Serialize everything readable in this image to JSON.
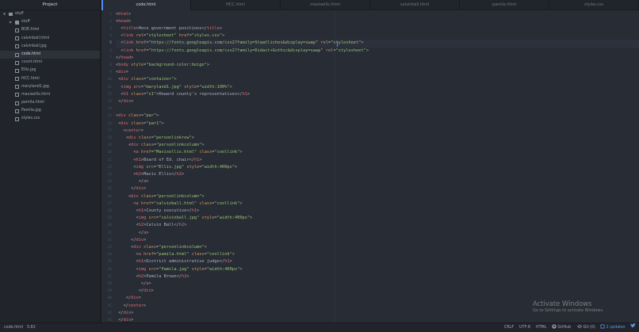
{
  "tree": {
    "header": "Project",
    "items": [
      {
        "label": "stuff",
        "type": "folder",
        "expanded": true,
        "depth": 0
      },
      {
        "label": "stuff",
        "type": "folder",
        "expanded": false,
        "depth": 1
      },
      {
        "label": "BOE.html",
        "type": "file",
        "depth": 1
      },
      {
        "label": "calvinball.html",
        "type": "file",
        "depth": 1
      },
      {
        "label": "calvinball.jpg",
        "type": "file",
        "depth": 1
      },
      {
        "label": "code.html",
        "type": "file",
        "depth": 1,
        "selected": true
      },
      {
        "label": "count.html",
        "type": "file",
        "depth": 1
      },
      {
        "label": "Ellis.jpg",
        "type": "file",
        "depth": 1
      },
      {
        "label": "HCC.html",
        "type": "file",
        "depth": 1
      },
      {
        "label": "maryland1.jpg",
        "type": "file",
        "depth": 1
      },
      {
        "label": "mavisellis.html",
        "type": "file",
        "depth": 1
      },
      {
        "label": "pamila.html",
        "type": "file",
        "depth": 1
      },
      {
        "label": "Pamila.jpg",
        "type": "file",
        "depth": 1
      },
      {
        "label": "styles.css",
        "type": "file",
        "depth": 1
      }
    ]
  },
  "tabs": [
    {
      "label": "code.html",
      "active": true
    },
    {
      "label": "HCC.html",
      "active": false
    },
    {
      "label": "mavisellis.html",
      "active": false
    },
    {
      "label": "calvinball.html",
      "active": false
    },
    {
      "label": "pamila.html",
      "active": false
    },
    {
      "label": "styles.css",
      "active": false
    }
  ],
  "editor": {
    "current_line": 5,
    "lines": [
      {
        "n": "1",
        "t": "<html>"
      },
      {
        "n": "2",
        "t": "<head>"
      },
      {
        "n": "3",
        "t": "  <title>Hoco government positions</title>"
      },
      {
        "n": "4",
        "t": "  <link rel=\"stylesheet\" href=\"styles.css\">"
      },
      {
        "n": "5",
        "t": "  <link href=\"https://fonts.googleapis.com/css2?family=Staatliches&display=swap\" rel=\"stylesheet\">"
      },
      {
        "n": "6",
        "t": "  <link href=\"https://fonts.googleapis.com/css2?family=Didact+Gothic&display=swap\" rel=\"stylesheet\">"
      },
      {
        "n": "7",
        "t": "</head>"
      },
      {
        "n": "8",
        "t": "<body style=\"background-color:beige\">"
      },
      {
        "n": "9",
        "t": "<div>"
      },
      {
        "n": "10",
        "t": " <div class=\"container\">"
      },
      {
        "n": "11",
        "t": "  <img src=\"maryland1.jpg\" style=\"width:100%\">"
      },
      {
        "n": "12",
        "t": "  <h1 class=\"x1\">Howard county's representatives</h1>"
      },
      {
        "n": "13",
        "t": " </div>"
      },
      {
        "n": "14",
        "t": ""
      },
      {
        "n": "15",
        "t": "<div class=\"par\">"
      },
      {
        "n": "16",
        "t": " <div class=\"par1\">"
      },
      {
        "n": "17",
        "t": "   <center>"
      },
      {
        "n": "18",
        "t": "    <div class=\"personlinkrow\">"
      },
      {
        "n": "19",
        "t": "     <div class=\"personlinkcolumn\">"
      },
      {
        "n": "20",
        "t": "       <a href=\"Mavisellis.html\" class=\"coollink\">"
      },
      {
        "n": "21",
        "t": "       <h1>Board of Ed. chair</h1>"
      },
      {
        "n": "22",
        "t": "       <img src=\"Ellis.jpg\" style=\"width:400px\">"
      },
      {
        "n": "23",
        "t": "       <h2>Mavis Ellis</h2>"
      },
      {
        "n": "24",
        "t": "         </a>"
      },
      {
        "n": "25",
        "t": "      </div>"
      },
      {
        "n": "26",
        "t": "     <div class=\"personlinkcolumn\">"
      },
      {
        "n": "27",
        "t": "       <a href=\"calvinball.html\" class=\"coollink\">"
      },
      {
        "n": "28",
        "t": "        <h1>County executive</h1>"
      },
      {
        "n": "29",
        "t": "        <img src=\"calvinball.jpg\" style=\"width:400px\">"
      },
      {
        "n": "30",
        "t": "        <h2>Calvin Ball</h2>"
      },
      {
        "n": "31",
        "t": "         </a>"
      },
      {
        "n": "32",
        "t": "      </div>"
      },
      {
        "n": "33",
        "t": "      <div class=\"personlinkcolumn\">"
      },
      {
        "n": "34",
        "t": "        <a href=\"pamila.html\" class=\"coollink\">"
      },
      {
        "n": "35",
        "t": "        <h1>District administrative judge</h1>"
      },
      {
        "n": "36",
        "t": "        <img src=\"Pamila.jpg\" style=\"width:400px\">"
      },
      {
        "n": "37",
        "t": "        <h2>Pamila Brown</h2>"
      },
      {
        "n": "38",
        "t": "          </a>"
      },
      {
        "n": "39",
        "t": "         </div>"
      },
      {
        "n": "40",
        "t": "    </div>"
      },
      {
        "n": "41",
        "t": "   </center>"
      },
      {
        "n": "42",
        "t": " </div>"
      },
      {
        "n": "43",
        "t": " </div>"
      }
    ]
  },
  "status": {
    "file": "code.html",
    "cursor": "5:82",
    "line_ending": "CRLF",
    "encoding": "UTF-8",
    "grammar": "HTML",
    "github": "GitHub",
    "git": "Git (0)",
    "updates": "2 updates"
  },
  "watermark": {
    "title": "Activate Windows",
    "subtitle": "Go to Settings to activate Windows."
  }
}
